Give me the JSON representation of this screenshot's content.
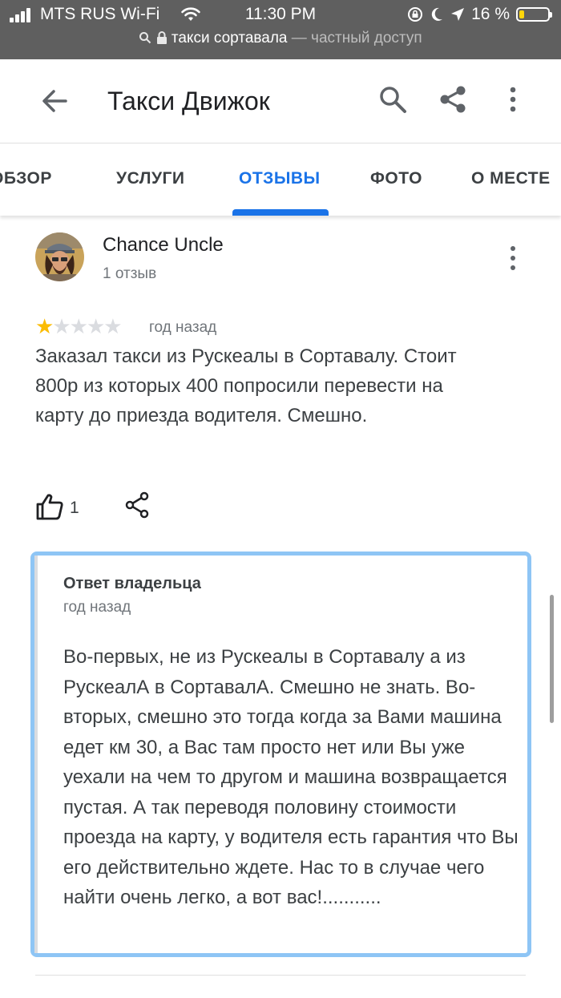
{
  "status_bar": {
    "carrier": "MTS RUS Wi-Fi",
    "time": "11:30 PM",
    "battery": "16 %",
    "battery_level": 0.16
  },
  "url_bar": {
    "host": "такси сортавала",
    "mode": "— частный доступ"
  },
  "app_bar": {
    "title": "Такси Движок",
    "icons": [
      "back-arrow-icon",
      "search-icon",
      "share-icon",
      "more-vert-icon"
    ]
  },
  "tabs": [
    {
      "label": "ОБЗОР"
    },
    {
      "label": "УСЛУГИ"
    },
    {
      "label": "ОТЗЫВЫ",
      "active": true
    },
    {
      "label": "ФОТО"
    },
    {
      "label": "О МЕСТЕ"
    }
  ],
  "review": {
    "author": "Chance Uncle",
    "author_reviews": "1 отзыв",
    "rating": 1,
    "rating_max": 5,
    "date": "год назад",
    "text": "Заказал такси из Рускеалы в Сортавалу. Стоит 800р из которых 400 попросили перевести на карту до приезда водителя. Смешно.",
    "likes": "1"
  },
  "owner_reply": {
    "title": "Ответ владельца",
    "date": "год назад",
    "text": "Во-первых, не из Рускеалы в Сортавалу а из РускеалА в СортавалА. Смешно не знать. Во-вторых, смешно это тогда когда за Вами машина едет км 30, а Вас там просто нет или Вы уже уехали на чем то другом и машина возвращается пустая. А так переводя половину стоимости проезда на карту, у водителя есть гарантия что Вы его действительно ждете. Нас то в случае чего найти очень легко, а вот вас!..........."
  },
  "colors": {
    "accent": "#1a73e8",
    "star": "#fbbc04",
    "reply_highlight": "#8ec5f5",
    "status_bar_bg": "#5f5f5f"
  }
}
